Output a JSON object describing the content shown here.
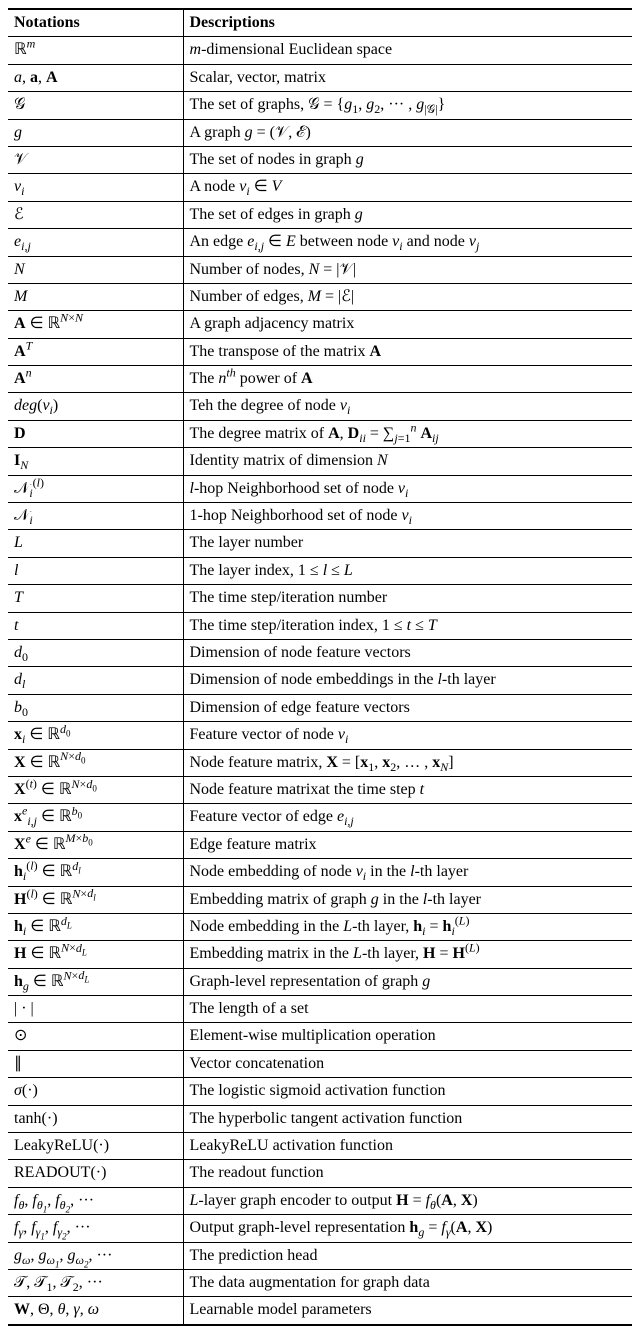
{
  "headers": {
    "notation": "Notations",
    "description": "Descriptions"
  },
  "rows": [
    {
      "n": "ℝ<sup><i>m</i></sup>",
      "d": "<i>m</i>-dimensional Euclidean space"
    },
    {
      "n": "<i>a</i>, <b>a</b>, <b>A</b>",
      "d": "Scalar, vector, matrix"
    },
    {
      "n": "𝒢",
      "d": "The set of graphs, 𝒢 = {<i>g</i><sub>1</sub>, <i>g</i><sub>2</sub>, ··· , <i>g</i><sub>|𝒢|</sub>}"
    },
    {
      "n": "<i>g</i>",
      "d": "A graph <i>g</i> = (𝒱, ℰ)"
    },
    {
      "n": "𝒱",
      "d": "The set of nodes in graph <i>g</i>"
    },
    {
      "n": "<i>v<sub>i</sub></i>",
      "d": "A node <i>v<sub>i</sub></i> ∈ <i>V</i>"
    },
    {
      "n": "ℰ",
      "d": "The set of edges in graph <i>g</i>"
    },
    {
      "n": "<i>e<sub>i,j</sub></i>",
      "d": "An edge <i>e<sub>i,j</sub></i> ∈ <i>E</i> between node <i>v<sub>i</sub></i> and node <i>v<sub>j</sub></i>"
    },
    {
      "n": "<i>N</i>",
      "d": "Number of nodes, <i>N</i> = |𝒱|"
    },
    {
      "n": "<i>M</i>",
      "d": "Number of edges, <i>M</i> = |ℰ|"
    },
    {
      "n": "<b>A</b> ∈ ℝ<sup><i>N</i>×<i>N</i></sup>",
      "d": "A graph adjacency matrix"
    },
    {
      "n": "<b>A</b><sup><i>T</i></sup>",
      "d": "The transpose of the matrix <b>A</b>"
    },
    {
      "n": "<b>A</b><sup><i>n</i></sup>",
      "d": "The <i>n<sup>th</sup></i> power of <b>A</b>"
    },
    {
      "n": "<i>deg</i>(<i>v<sub>i</sub></i>)",
      "d": "Teh the degree of node <i>v<sub>i</sub></i>"
    },
    {
      "n": "<b>D</b>",
      "d": "The degree matrix of <b>A</b>, <b>D</b><sub><i>ii</i></sub> = ∑<sub><i>j</i>=1</sub><sup><i>n</i></sup> <b>A</b><sub><i>ij</i></sub>"
    },
    {
      "n": "<b>I</b><sub><i>N</i></sub>",
      "d": "Identity matrix of dimension <i>N</i>"
    },
    {
      "n": "𝒩<sub><i>i</i></sub><sup>(<i>l</i>)</sup>",
      "d": "<i>l</i>-hop Neighborhood set of node <i>v<sub>i</sub></i>"
    },
    {
      "n": "𝒩<sub><i>i</i></sub>",
      "d": "1-hop Neighborhood set of node <i>v<sub>i</sub></i>"
    },
    {
      "n": "<i>L</i>",
      "d": "The layer number"
    },
    {
      "n": "<i>l</i>",
      "d": "The layer index, 1 ≤ <i>l</i> ≤ <i>L</i>"
    },
    {
      "n": "<i>T</i>",
      "d": "The time step/iteration number"
    },
    {
      "n": "<i>t</i>",
      "d": "The time step/iteration index, 1 ≤ <i>t</i> ≤ <i>T</i>"
    },
    {
      "n": "<i>d</i><sub>0</sub>",
      "d": "Dimension of node feature vectors"
    },
    {
      "n": "<i>d<sub>l</sub></i>",
      "d": "Dimension of node embeddings in the <i>l</i>-th layer"
    },
    {
      "n": "<i>b</i><sub>0</sub>",
      "d": "Dimension of edge feature vectors"
    },
    {
      "n": "<b>x</b><sub><i>i</i></sub> ∈ ℝ<sup><i>d</i><sub>0</sub></sup>",
      "d": "Feature vector of node <i>v<sub>i</sub></i>"
    },
    {
      "n": "<b>X</b> ∈ ℝ<sup><i>N</i>×<i>d</i><sub>0</sub></sup>",
      "d": "Node feature matrix, <b>X</b> = [<b>x</b><sub>1</sub>, <b>x</b><sub>2</sub>, … , <b>x</b><sub><i>N</i></sub>]"
    },
    {
      "n": "<b>X</b><sup>(<i>t</i>)</sup> ∈ ℝ<sup><i>N</i>×<i>d</i><sub>0</sub></sup>",
      "d": "Node feature matrixat the time step <i>t</i>"
    },
    {
      "n": "<b>x</b><sup><i>e</i></sup><sub><i>i,j</i></sub> ∈ ℝ<sup><i>b</i><sub>0</sub></sup>",
      "d": "Feature vector of edge <i>e<sub>i,j</sub></i>"
    },
    {
      "n": "<b>X</b><sup><i>e</i></sup> ∈ ℝ<sup><i>M</i>×<i>b</i><sub>0</sub></sup>",
      "d": "Edge feature matrix"
    },
    {
      "n": "<b>h</b><sub><i>i</i></sub><sup>(<i>l</i>)</sup> ∈ ℝ<sup><i>d<sub>l</sub></i></sup>",
      "d": "Node embedding of node <i>v<sub>i</sub></i> in the <i>l</i>-th layer"
    },
    {
      "n": "<b>H</b><sup>(<i>l</i>)</sup> ∈ ℝ<sup><i>N</i>×<i>d<sub>l</sub></i></sup>",
      "d": "Embedding matrix of graph <i>g</i> in the <i>l</i>-th layer"
    },
    {
      "n": "<b>h</b><sub><i>i</i></sub> ∈ ℝ<sup><i>d<sub>L</sub></i></sup>",
      "d": "Node embedding in the <i>L</i>-th layer, <b>h</b><sub><i>i</i></sub> = <b>h</b><sub><i>i</i></sub><sup>(<i>L</i>)</sup>"
    },
    {
      "n": "<b>H</b> ∈ ℝ<sup><i>N</i>×<i>d<sub>L</sub></i></sup>",
      "d": "Embedding matrix in the <i>L</i>-th layer, <b>H</b> = <b>H</b><sup>(<i>L</i>)</sup>"
    },
    {
      "n": "<b>h</b><sub><i>g</i></sub> ∈ ℝ<sup><i>N</i>×<i>d<sub>L</sub></i></sup>",
      "d": "Graph-level representation of graph <i>g</i>"
    },
    {
      "n": "| · |",
      "d": "The length of a set"
    },
    {
      "n": "⊙",
      "d": "Element-wise multiplication operation"
    },
    {
      "n": "∥",
      "d": "Vector concatenation"
    },
    {
      "n": "<i>σ</i>(·)",
      "d": "The logistic sigmoid activation function"
    },
    {
      "n": "tanh(·)",
      "d": "The hyperbolic tangent activation function"
    },
    {
      "n": "LeakyReLU(·)",
      "d": "LeakyReLU activation function"
    },
    {
      "n": "READOUT(·)",
      "d": "The readout function"
    },
    {
      "n": "<i>f<sub>θ</sub></i>, <i>f<sub>θ<sub>1</sub></sub></i>, <i>f<sub>θ<sub>2</sub></sub></i>, ···",
      "d": "<i>L</i>-layer graph encoder to output <b>H</b> = <i>f<sub>θ</sub></i>(<b>A</b>, <b>X</b>)"
    },
    {
      "n": "<i>f<sub>γ</sub></i>, <i>f<sub>γ<sub>1</sub></sub></i>, <i>f<sub>γ<sub>2</sub></sub></i>, ···",
      "d": "Output graph-level representation <b>h</b><sub><i>g</i></sub> = <i>f<sub>γ</sub></i>(<b>A</b>, <b>X</b>)"
    },
    {
      "n": "<i>g<sub>ω</sub></i>, <i>g<sub>ω<sub>1</sub></sub></i>, <i>g<sub>ω<sub>2</sub></sub></i>, ···",
      "d": "The prediction head"
    },
    {
      "n": "𝒯, 𝒯<sub>1</sub>, 𝒯<sub>2</sub>, ···",
      "d": "The data augmentation for graph data"
    },
    {
      "n": "<b>W</b>, Θ, <i>θ</i>, <i>γ</i>, <i>ω</i>",
      "d": "Learnable model parameters"
    }
  ]
}
